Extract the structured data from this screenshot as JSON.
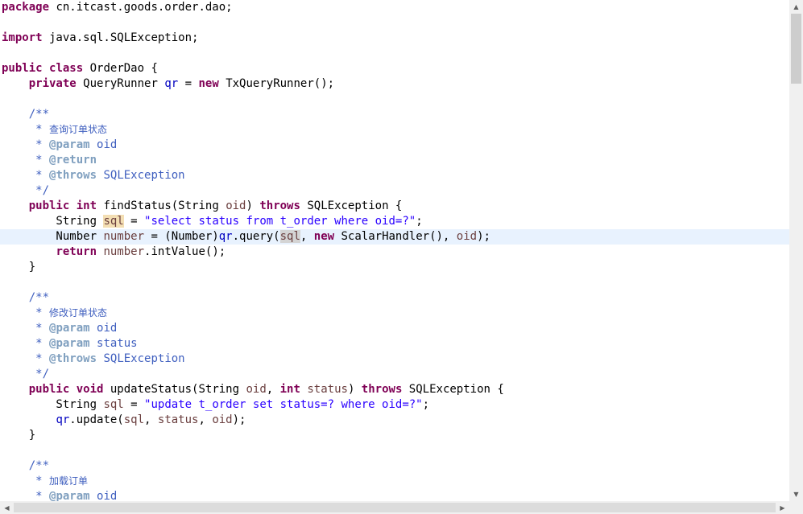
{
  "editor": {
    "lines": [
      {
        "tokens": [
          {
            "t": "package",
            "c": "kw"
          },
          {
            "t": " cn.itcast.goods.order.dao;"
          }
        ]
      },
      {
        "tokens": []
      },
      {
        "tokens": [
          {
            "t": "import",
            "c": "kw"
          },
          {
            "t": " java.sql.SQLException;"
          }
        ]
      },
      {
        "tokens": []
      },
      {
        "tokens": [
          {
            "t": "public",
            "c": "kw"
          },
          {
            "t": " "
          },
          {
            "t": "class",
            "c": "kw"
          },
          {
            "t": " OrderDao {"
          }
        ]
      },
      {
        "tokens": [
          {
            "t": "    "
          },
          {
            "t": "private",
            "c": "kw"
          },
          {
            "t": " QueryRunner "
          },
          {
            "t": "qr",
            "c": "fld"
          },
          {
            "t": " = "
          },
          {
            "t": "new",
            "c": "kw"
          },
          {
            "t": " TxQueryRunner();"
          }
        ]
      },
      {
        "tokens": []
      },
      {
        "tokens": [
          {
            "t": "    /**",
            "c": "cm"
          }
        ]
      },
      {
        "tokens": [
          {
            "t": "     * ",
            "c": "cm"
          },
          {
            "t": "查询订单状态",
            "c": "cm cjk"
          }
        ]
      },
      {
        "tokens": [
          {
            "t": "     * ",
            "c": "cm"
          },
          {
            "t": "@param",
            "c": "tag"
          },
          {
            "t": " oid",
            "c": "cm"
          }
        ]
      },
      {
        "tokens": [
          {
            "t": "     * ",
            "c": "cm"
          },
          {
            "t": "@return",
            "c": "tag"
          }
        ]
      },
      {
        "tokens": [
          {
            "t": "     * ",
            "c": "cm"
          },
          {
            "t": "@throws",
            "c": "tag"
          },
          {
            "t": " SQLException",
            "c": "cm"
          }
        ]
      },
      {
        "tokens": [
          {
            "t": "     */",
            "c": "cm"
          }
        ]
      },
      {
        "tokens": [
          {
            "t": "    "
          },
          {
            "t": "public",
            "c": "kw"
          },
          {
            "t": " "
          },
          {
            "t": "int",
            "c": "kw"
          },
          {
            "t": " findStatus(String "
          },
          {
            "t": "oid",
            "c": "var"
          },
          {
            "t": ") "
          },
          {
            "t": "throws",
            "c": "kw"
          },
          {
            "t": " SQLException {"
          }
        ]
      },
      {
        "tokens": [
          {
            "t": "        String "
          },
          {
            "t": "sql",
            "c": "var occw"
          },
          {
            "t": " = "
          },
          {
            "t": "\"select status from t_order where oid=?\"",
            "c": "str"
          },
          {
            "t": ";"
          }
        ]
      },
      {
        "current": true,
        "tokens": [
          {
            "t": "        Number "
          },
          {
            "t": "number",
            "c": "var"
          },
          {
            "t": " = (Number)"
          },
          {
            "t": "qr",
            "c": "fld"
          },
          {
            "t": ".query("
          },
          {
            "t": "sql",
            "c": "var occ"
          },
          {
            "t": ", "
          },
          {
            "t": "new",
            "c": "kw"
          },
          {
            "t": " ScalarHandler(), "
          },
          {
            "t": "oid",
            "c": "var"
          },
          {
            "t": ");"
          }
        ]
      },
      {
        "tokens": [
          {
            "t": "        "
          },
          {
            "t": "return",
            "c": "kw"
          },
          {
            "t": " "
          },
          {
            "t": "number",
            "c": "var"
          },
          {
            "t": ".intValue();"
          }
        ]
      },
      {
        "tokens": [
          {
            "t": "    }"
          }
        ]
      },
      {
        "tokens": []
      },
      {
        "tokens": [
          {
            "t": "    /**",
            "c": "cm"
          }
        ]
      },
      {
        "tokens": [
          {
            "t": "     * ",
            "c": "cm"
          },
          {
            "t": "修改订单状态",
            "c": "cm cjk"
          }
        ]
      },
      {
        "tokens": [
          {
            "t": "     * ",
            "c": "cm"
          },
          {
            "t": "@param",
            "c": "tag"
          },
          {
            "t": " oid",
            "c": "cm"
          }
        ]
      },
      {
        "tokens": [
          {
            "t": "     * ",
            "c": "cm"
          },
          {
            "t": "@param",
            "c": "tag"
          },
          {
            "t": " status",
            "c": "cm"
          }
        ]
      },
      {
        "tokens": [
          {
            "t": "     * ",
            "c": "cm"
          },
          {
            "t": "@throws",
            "c": "tag"
          },
          {
            "t": " SQLException",
            "c": "cm"
          }
        ]
      },
      {
        "tokens": [
          {
            "t": "     */",
            "c": "cm"
          }
        ]
      },
      {
        "tokens": [
          {
            "t": "    "
          },
          {
            "t": "public",
            "c": "kw"
          },
          {
            "t": " "
          },
          {
            "t": "void",
            "c": "kw"
          },
          {
            "t": " updateStatus(String "
          },
          {
            "t": "oid",
            "c": "var"
          },
          {
            "t": ", "
          },
          {
            "t": "int",
            "c": "kw"
          },
          {
            "t": " "
          },
          {
            "t": "status",
            "c": "var"
          },
          {
            "t": ") "
          },
          {
            "t": "throws",
            "c": "kw"
          },
          {
            "t": " SQLException {"
          }
        ]
      },
      {
        "tokens": [
          {
            "t": "        String "
          },
          {
            "t": "sql",
            "c": "var"
          },
          {
            "t": " = "
          },
          {
            "t": "\"update t_order set status=? where oid=?\"",
            "c": "str"
          },
          {
            "t": ";"
          }
        ]
      },
      {
        "tokens": [
          {
            "t": "        "
          },
          {
            "t": "qr",
            "c": "fld"
          },
          {
            "t": ".update("
          },
          {
            "t": "sql",
            "c": "var"
          },
          {
            "t": ", "
          },
          {
            "t": "status",
            "c": "var"
          },
          {
            "t": ", "
          },
          {
            "t": "oid",
            "c": "var"
          },
          {
            "t": ");"
          }
        ]
      },
      {
        "tokens": [
          {
            "t": "    }"
          }
        ]
      },
      {
        "tokens": []
      },
      {
        "tokens": [
          {
            "t": "    /**",
            "c": "cm"
          }
        ]
      },
      {
        "tokens": [
          {
            "t": "     * ",
            "c": "cm"
          },
          {
            "t": "加载订单",
            "c": "cm cjk"
          }
        ]
      },
      {
        "tokens": [
          {
            "t": "     * ",
            "c": "cm"
          },
          {
            "t": "@param",
            "c": "tag"
          },
          {
            "t": " oid",
            "c": "cm"
          }
        ]
      }
    ]
  },
  "scrollbars": {
    "up_icon": "triangle-up-icon",
    "down_icon": "triangle-down-icon",
    "left_icon": "triangle-left-icon",
    "right_icon": "triangle-right-icon"
  }
}
